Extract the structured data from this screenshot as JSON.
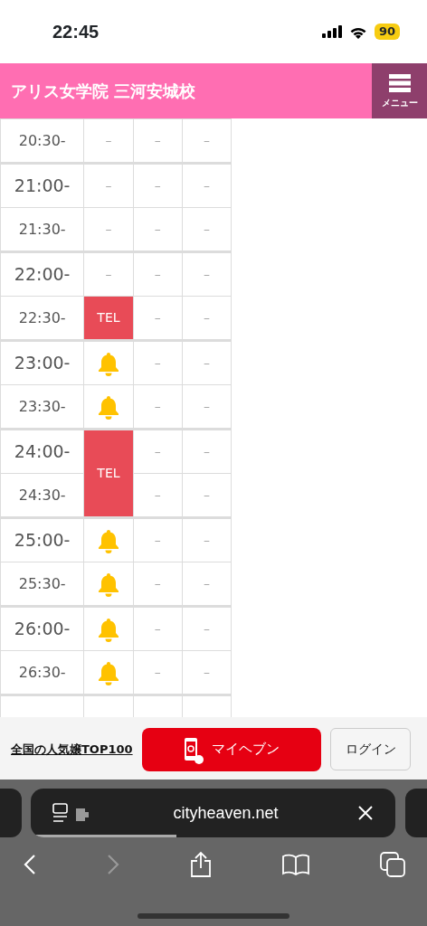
{
  "status_bar": {
    "time": "22:45",
    "battery": "90"
  },
  "header": {
    "title": "アリス女学院 三河安城校",
    "menu_label": "メニュー"
  },
  "schedule": {
    "rows": [
      {
        "time": "20:30-",
        "hour": false,
        "cells": [
          {
            "kind": "none",
            "text": "–"
          },
          {
            "kind": "none",
            "text": "–"
          },
          {
            "kind": "none",
            "text": "–"
          }
        ]
      },
      {
        "time": "21:00-",
        "hour": true,
        "cells": [
          {
            "kind": "none",
            "text": "–"
          },
          {
            "kind": "none",
            "text": "–"
          },
          {
            "kind": "none",
            "text": "–"
          }
        ]
      },
      {
        "time": "21:30-",
        "hour": false,
        "cells": [
          {
            "kind": "none",
            "text": "–"
          },
          {
            "kind": "none",
            "text": "–"
          },
          {
            "kind": "none",
            "text": "–"
          }
        ]
      },
      {
        "time": "22:00-",
        "hour": true,
        "cells": [
          {
            "kind": "none",
            "text": "–"
          },
          {
            "kind": "none",
            "text": "–"
          },
          {
            "kind": "none",
            "text": "–"
          }
        ]
      },
      {
        "time": "22:30-",
        "hour": false,
        "cells": [
          {
            "kind": "tel",
            "text": "TEL"
          },
          {
            "kind": "none",
            "text": "–"
          },
          {
            "kind": "none",
            "text": "–"
          }
        ]
      },
      {
        "time": "23:00-",
        "hour": true,
        "cells": [
          {
            "kind": "bell"
          },
          {
            "kind": "none",
            "text": "–"
          },
          {
            "kind": "none",
            "text": "–"
          }
        ]
      },
      {
        "time": "23:30-",
        "hour": false,
        "cells": [
          {
            "kind": "bell"
          },
          {
            "kind": "none",
            "text": "–"
          },
          {
            "kind": "none",
            "text": "–"
          }
        ]
      },
      {
        "time": "24:00-",
        "hour": true,
        "cells": [
          {
            "kind": "tel",
            "text": "TEL",
            "rowspan": 2
          },
          {
            "kind": "none",
            "text": "–"
          },
          {
            "kind": "none",
            "text": "–"
          }
        ]
      },
      {
        "time": "24:30-",
        "hour": false,
        "cells": [
          {
            "kind": "none",
            "text": "–"
          },
          {
            "kind": "none",
            "text": "–"
          }
        ]
      },
      {
        "time": "25:00-",
        "hour": true,
        "cells": [
          {
            "kind": "bell"
          },
          {
            "kind": "none",
            "text": "–"
          },
          {
            "kind": "none",
            "text": "–"
          }
        ]
      },
      {
        "time": "25:30-",
        "hour": false,
        "cells": [
          {
            "kind": "bell"
          },
          {
            "kind": "none",
            "text": "–"
          },
          {
            "kind": "none",
            "text": "–"
          }
        ]
      },
      {
        "time": "26:00-",
        "hour": true,
        "cells": [
          {
            "kind": "bell"
          },
          {
            "kind": "none",
            "text": "–"
          },
          {
            "kind": "none",
            "text": "–"
          }
        ]
      },
      {
        "time": "26:30-",
        "hour": false,
        "cells": [
          {
            "kind": "bell"
          },
          {
            "kind": "none",
            "text": "–"
          },
          {
            "kind": "none",
            "text": "–"
          }
        ]
      }
    ]
  },
  "promo_bar": {
    "link": "全国の人気嬢TOP100",
    "primary_button": "マイヘブン",
    "login_button": "ログイン"
  },
  "browser": {
    "url": "cityheaven.net",
    "progress": {
      "level": 0.4
    },
    "forward_disabled": true
  }
}
